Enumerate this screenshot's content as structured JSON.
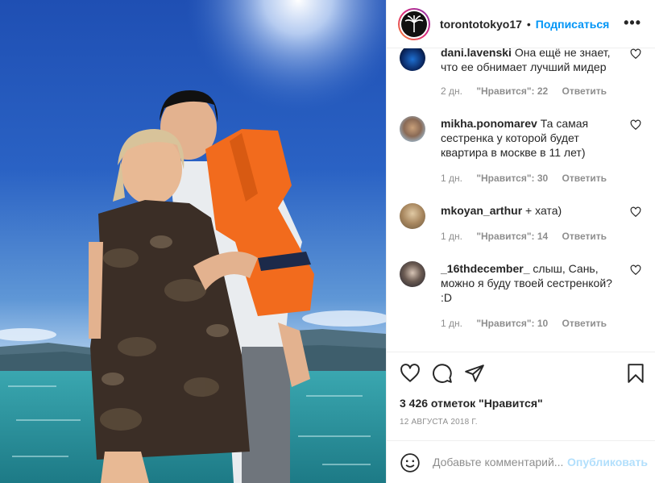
{
  "header": {
    "username": "torontotokyo17",
    "separator": "•",
    "follow_label": "Подписаться",
    "more_label": "•••"
  },
  "comments": [
    {
      "user": "dani.lavenski",
      "text": "Она ещё не знает, что ее обнимает лучший мидер",
      "age": "2 дн.",
      "likes": "\"Нравится\": 22",
      "reply": "Ответить"
    },
    {
      "user": "mikha.ponomarev",
      "text": "Та самая сестренка у которой будет квартира в москве в 11 лет)",
      "age": "1 дн.",
      "likes": "\"Нравится\": 30",
      "reply": "Ответить"
    },
    {
      "user": "mkoyan_arthur",
      "text": "+ хата)",
      "age": "1 дн.",
      "likes": "\"Нравится\": 14",
      "reply": "Ответить"
    },
    {
      "user": "_16thdecember_",
      "text": "слыш, Сань, можно я буду твоей сестренкой? :D",
      "age": "1 дн.",
      "likes": "\"Нравится\": 10",
      "reply": "Ответить"
    }
  ],
  "post": {
    "likes_text": "3 426 отметок \"Нравится\"",
    "date": "12 АВГУСТА 2018 Г."
  },
  "add_comment": {
    "placeholder": "Добавьте комментарий...",
    "publish_label": "Опубликовать"
  },
  "icons": {
    "like": "heart-icon",
    "comment": "comment-icon",
    "share": "share-icon",
    "save": "bookmark-icon",
    "emoji": "smiley-icon"
  },
  "colors": {
    "accent": "#0095f6",
    "muted": "#8e8e8e",
    "publish_disabled": "#b2dffc"
  }
}
